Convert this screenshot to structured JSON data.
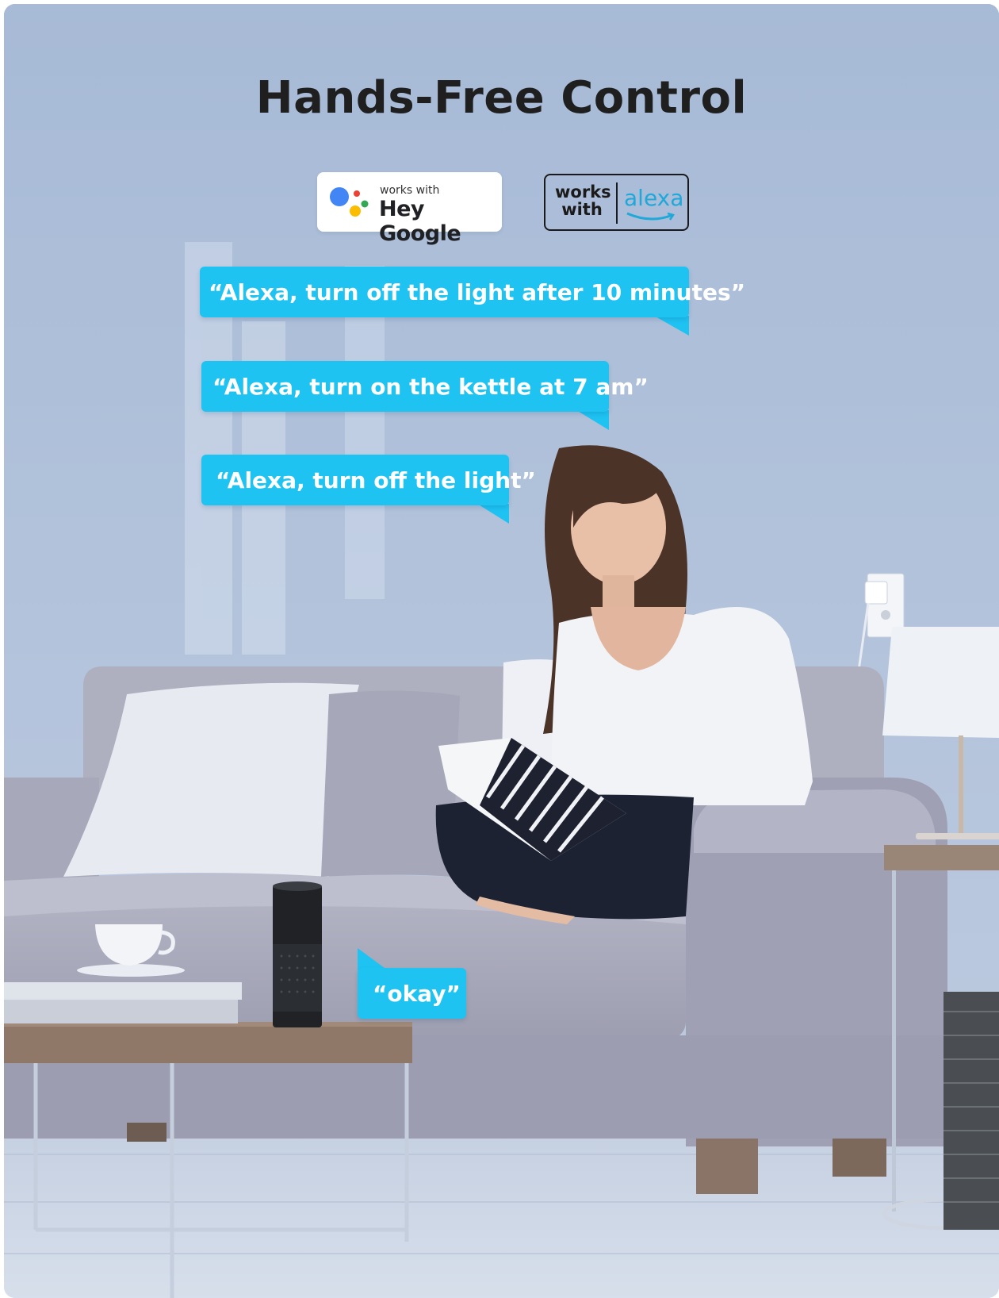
{
  "title": "Hands-Free Control",
  "badges": {
    "google": {
      "small": "works with",
      "big": "Hey Google",
      "dot_colors": [
        "#4285f4",
        "#ea4335",
        "#fbbc04",
        "#34a853"
      ]
    },
    "alexa": {
      "works_line1": "works",
      "works_line2": "with",
      "brand": "alexa",
      "brand_color": "#1fa8d8"
    }
  },
  "bubbles": [
    {
      "text": "“Alexa, turn off the light after 10 minutes”"
    },
    {
      "text": "“Alexa, turn on the kettle at 7 am”"
    },
    {
      "text": "“Alexa, turn off the light”"
    },
    {
      "text": "“okay”"
    }
  ],
  "colors": {
    "bubble": "#1ec3f2",
    "wall": "#b3c4de",
    "sofa": "#a8a9b9"
  }
}
